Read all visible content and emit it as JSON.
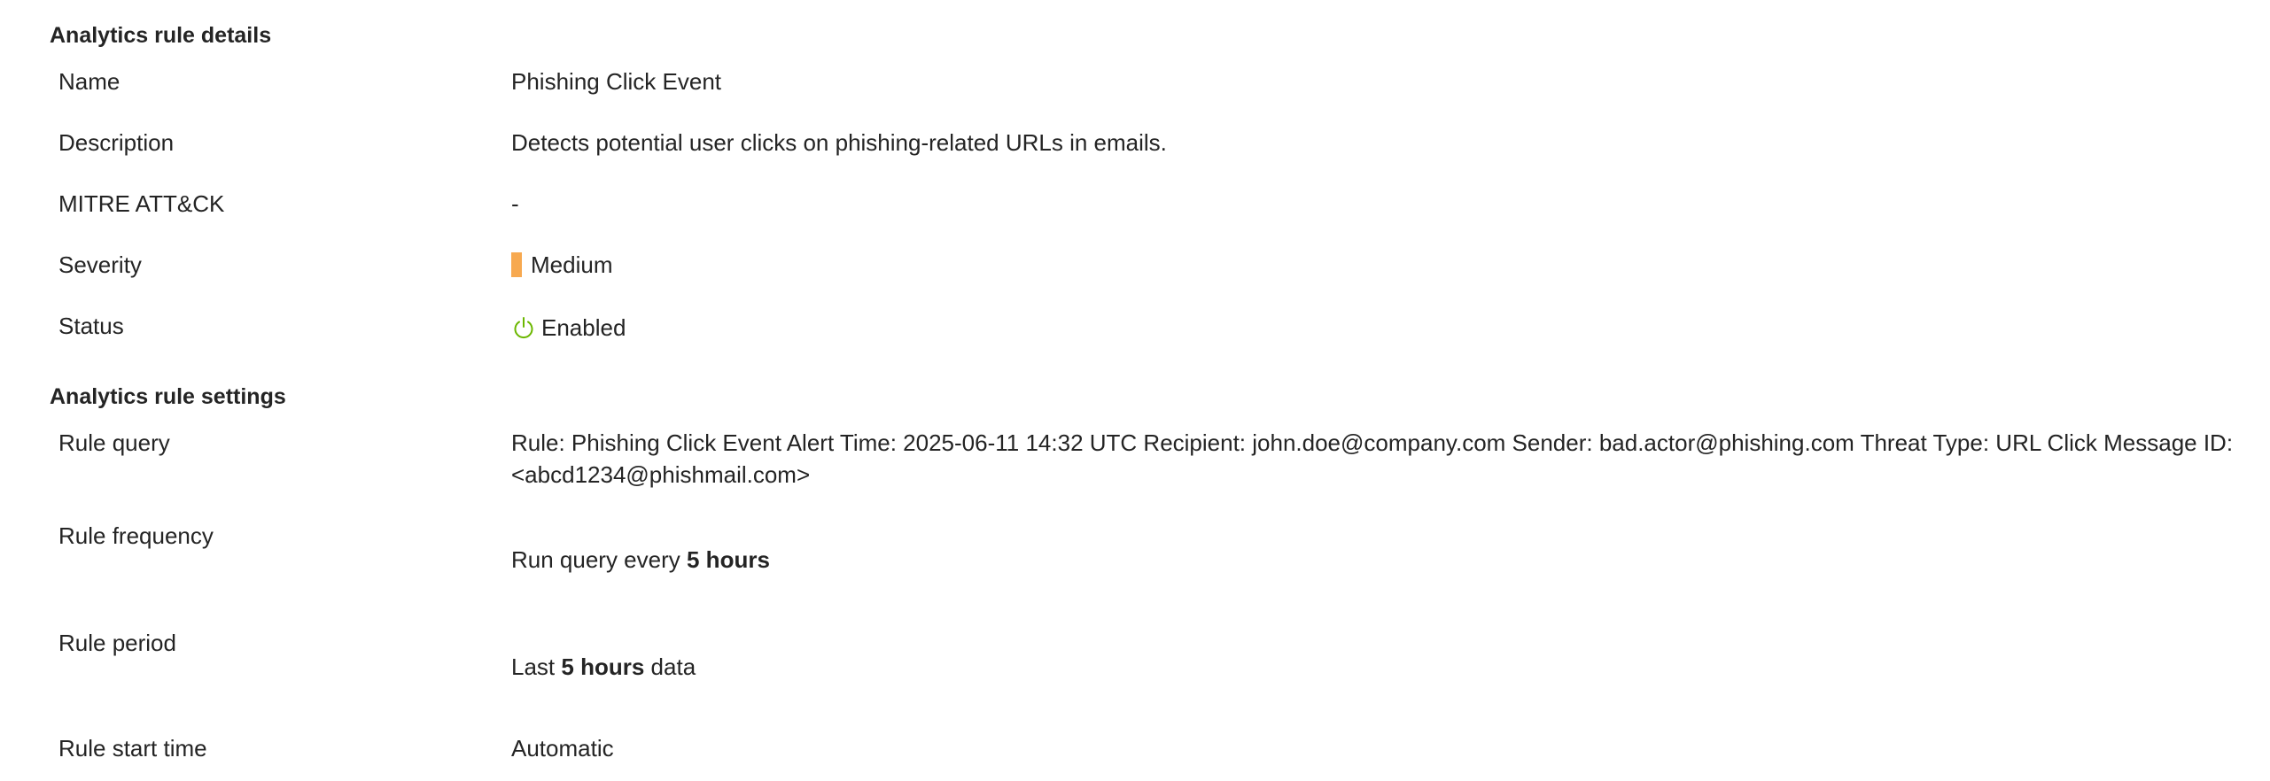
{
  "details": {
    "section_title": "Analytics rule details",
    "name_label": "Name",
    "name_value": "Phishing Click Event",
    "description_label": "Description",
    "description_value": "Detects potential user clicks on phishing-related URLs in emails.",
    "mitre_label": "MITRE ATT&CK",
    "mitre_value": "-",
    "severity_label": "Severity",
    "severity_value": "Medium",
    "severity_color": "#f7a950",
    "status_label": "Status",
    "status_value": "Enabled",
    "status_icon": "power-icon",
    "status_color": "#6bb700"
  },
  "settings": {
    "section_title": "Analytics rule settings",
    "query_label": "Rule query",
    "query_value": "Rule: Phishing Click Event Alert Time: 2025-06-11 14:32 UTC Recipient: john.doe@company.com Sender: bad.actor@phishing.com Threat Type: URL Click Message ID: <abcd1234@phishmail.com>",
    "frequency_label": "Rule frequency",
    "frequency_prefix": "Run query every",
    "frequency_value": "5 hours",
    "period_label": "Rule period",
    "period_prefix": "Last",
    "period_value": "5 hours",
    "period_suffix": "data",
    "start_time_label": "Rule start time",
    "start_time_value": "Automatic"
  }
}
